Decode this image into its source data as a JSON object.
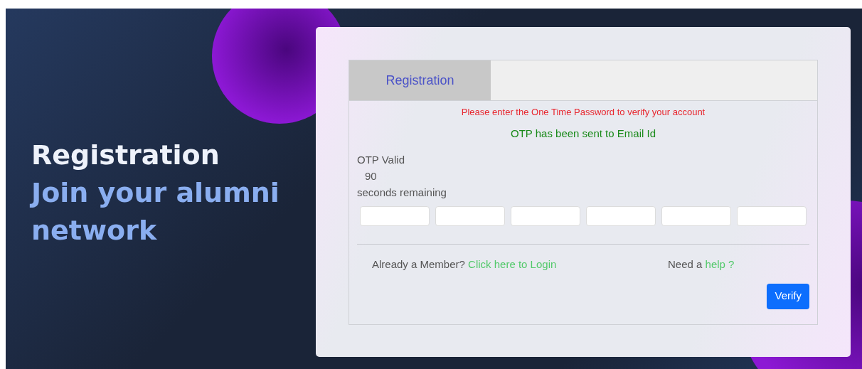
{
  "hero": {
    "title": "Registration",
    "subtitle": "Join your alumni network"
  },
  "tabs": [
    {
      "label": "Registration",
      "selected": true
    }
  ],
  "messages": [
    {
      "kind": "error",
      "text": "Please enter the One Time Password to verify your account"
    },
    {
      "kind": "success",
      "text": "OTP has been sent to Email Id"
    }
  ],
  "timer": {
    "label": "OTP Valid",
    "seconds": "90",
    "suffix": "seconds remaining"
  },
  "otp_fields": [
    {
      "kind": "digit"
    },
    {
      "kind": "digit"
    },
    {
      "kind": "digit"
    },
    {
      "kind": "digit"
    },
    {
      "kind": "digit"
    },
    {
      "kind": "digit"
    }
  ],
  "login_prompt": {
    "text": "Already a Member?",
    "link": "Click here to Login"
  },
  "help_prompt": {
    "text": "Need a",
    "link": "help ?"
  },
  "buttons": [
    "Verify"
  ]
}
